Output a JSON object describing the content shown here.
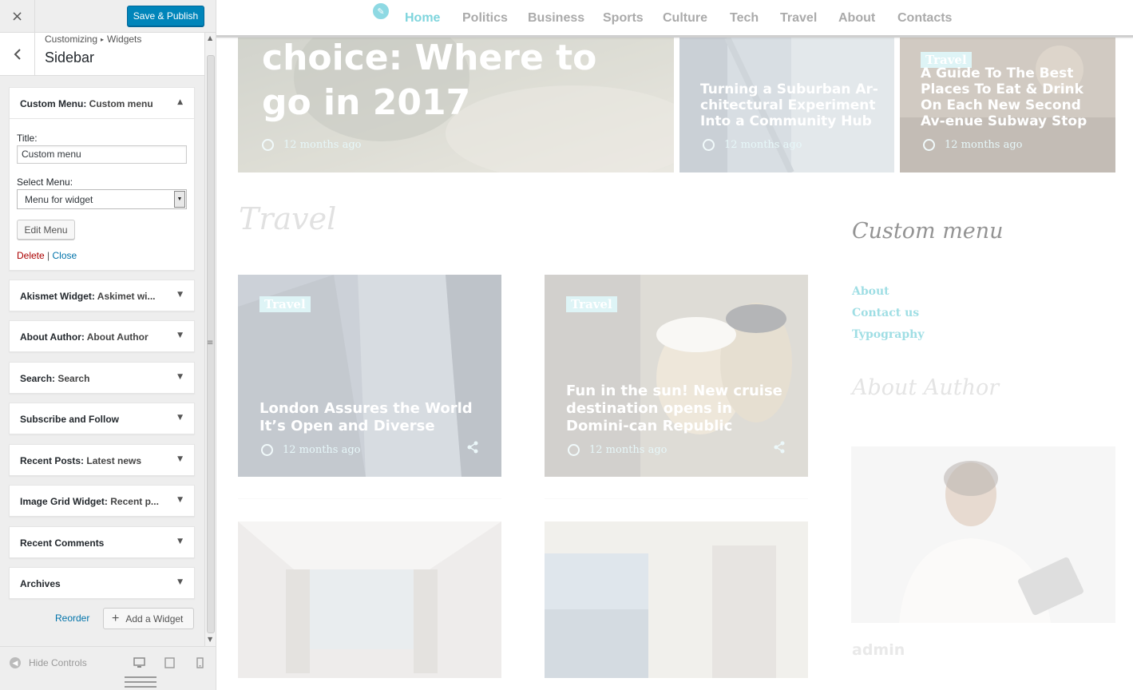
{
  "customizer": {
    "close_label": "×",
    "publish_label": "Save & Publish",
    "back_label": "‹",
    "breadcrumb": {
      "first": "Customizing",
      "separator": "▸",
      "second": "Widgets"
    },
    "section_title": "Sidebar",
    "open_widget": {
      "title_main": "Custom Menu:",
      "title_sub": "Custom menu",
      "title_label": "Title:",
      "title_value": "Custom menu",
      "select_label": "Select Menu:",
      "select_value": "Menu for widget",
      "edit_menu_label": "Edit Menu",
      "delete_label": "Delete",
      "link_separator": "|",
      "close_label": "Close"
    },
    "widgets": [
      {
        "main": "Akismet Widget:",
        "sub": "Askimet wi..."
      },
      {
        "main": "About Author:",
        "sub": "About Author"
      },
      {
        "main": "Search:",
        "sub": "Search"
      },
      {
        "main": "Subscribe and Follow",
        "sub": ""
      },
      {
        "main": "Recent Posts:",
        "sub": "Latest news"
      },
      {
        "main": "Image Grid Widget:",
        "sub": "Recent p..."
      },
      {
        "main": "Recent Comments",
        "sub": ""
      },
      {
        "main": "Archives",
        "sub": ""
      }
    ],
    "reorder_label": "Reorder",
    "add_widget_label": "Add a Widget",
    "hide_controls_label": "Hide Controls"
  },
  "preview": {
    "nav": [
      "Home",
      "Politics",
      "Business",
      "Sports",
      "Culture",
      "Tech",
      "Travel",
      "About",
      "Contacts"
    ],
    "hero": {
      "title": "choice: Where to go in 2017",
      "time": "12 months ago"
    },
    "hero_side": [
      {
        "title": "Turning a Suburban Ar-chitectural Experiment Into a Community Hub",
        "time": "12 months ago"
      },
      {
        "tag": "Travel",
        "title": "A Guide To The Best Places To Eat & Drink On Each New Second Av-enue Subway Stop",
        "time": "12 months ago"
      }
    ],
    "section_title": "Travel",
    "posts": [
      {
        "tag": "Travel",
        "title": "London Assures the World It’s Open and Diverse",
        "time": "12 months ago"
      },
      {
        "tag": "Travel",
        "title": "Fun in the sun! New cruise destination opens in Domini-can Republic",
        "time": "12 months ago"
      }
    ],
    "sidebar": {
      "menu_title": "Custom menu",
      "menu_links": [
        "About",
        "Contact us",
        "Typography"
      ],
      "author_title": "About Author",
      "author_name": "admin"
    }
  }
}
